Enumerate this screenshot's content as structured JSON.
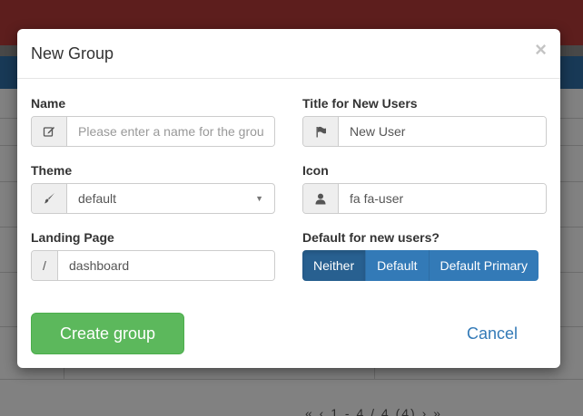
{
  "background": {
    "pager_text": "«  ‹  1 - 4 / 4 (4)  ›  »"
  },
  "modal": {
    "title": "New Group",
    "close_label": "×",
    "fields": {
      "name": {
        "label": "Name",
        "placeholder": "Please enter a name for the group",
        "value": "",
        "icon": "pencil-square-icon"
      },
      "title_new_users": {
        "label": "Title for New Users",
        "value": "New User",
        "icon": "flag-icon"
      },
      "theme": {
        "label": "Theme",
        "value": "default",
        "icon": "paint-brush-icon"
      },
      "icon": {
        "label": "Icon",
        "value": "fa fa-user",
        "icon": "user-icon"
      },
      "landing_page": {
        "label": "Landing Page",
        "prefix": "/",
        "value": "dashboard"
      },
      "default_for_new_users": {
        "label": "Default for new users?",
        "options": [
          "Neither",
          "Default",
          "Default Primary"
        ],
        "selected": "Neither"
      }
    },
    "buttons": {
      "create": "Create group",
      "cancel": "Cancel"
    }
  },
  "colors": {
    "primary": "#337ab7",
    "primary_active": "#286090",
    "success": "#5cb85c",
    "header_bar": "#b23a38"
  }
}
